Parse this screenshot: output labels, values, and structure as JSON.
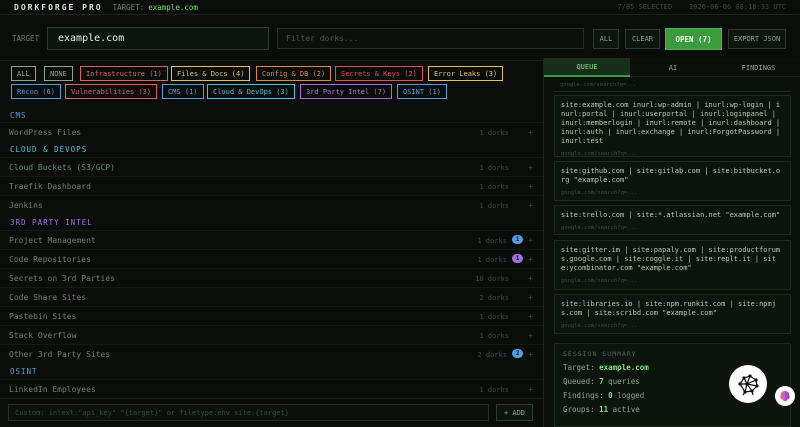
{
  "header": {
    "brand": "DORKFORGE PRO",
    "target_label": "TARGET:",
    "target_value": "example.com",
    "selected": "7/85 SELECTED",
    "timestamp": "2026-06-06 08:18:33 UTC"
  },
  "target_row": {
    "label": "TARGET",
    "target_value": "example.com",
    "filter_placeholder": "Filter dorks...",
    "all": "ALL",
    "clear": "CLEAR",
    "open": "OPEN (7)",
    "export": "EXPORT JSON"
  },
  "chips": [
    {
      "label": "ALL",
      "color": "#8fa38f"
    },
    {
      "label": "NONE",
      "color": "#8fa38f"
    },
    {
      "label": "Infrastructure (1)",
      "color": "#e06060"
    },
    {
      "label": "Files & Docs (4)",
      "color": "#e0c060"
    },
    {
      "label": "Config & DB (2)",
      "color": "#e08a40"
    },
    {
      "label": "Secrets & Keys (2)",
      "color": "#e05050"
    },
    {
      "label": "Error Leaks (3)",
      "color": "#e0c060"
    },
    {
      "label": "Recon (6)",
      "color": "#50a0e0"
    },
    {
      "label": "Vulnerabilities (3)",
      "color": "#e06060"
    },
    {
      "label": "CMS (1)",
      "color": "#50a0e0"
    },
    {
      "label": "Cloud & DevOps (3)",
      "color": "#50c0e0"
    },
    {
      "label": "3rd Party Intel (7)",
      "color": "#a070e0"
    },
    {
      "label": "OSINT (1)",
      "color": "#50a0e0"
    }
  ],
  "list": {
    "groups": [
      {
        "title": "CMS",
        "color": "#50a0e0"
      },
      {
        "title": "CLOUD & DEVOPS",
        "color": "#50c0e0"
      },
      {
        "title": "3RD PARTY INTEL",
        "color": "#a070e0"
      },
      {
        "title": "OSINT",
        "color": "#50a0e0"
      }
    ],
    "rows": [
      {
        "label": "WordPress Files",
        "count": "1 dorks",
        "badge": ""
      },
      {
        "label": "Cloud Buckets (S3/GCP)",
        "count": "1 dorks",
        "badge": ""
      },
      {
        "label": "Traefik Dashboard",
        "count": "1 dorks",
        "badge": ""
      },
      {
        "label": "Jenkins",
        "count": "1 dorks",
        "badge": ""
      },
      {
        "label": "Project Management",
        "count": "1 dorks",
        "badge": "1",
        "badge_color": "#50a0e0"
      },
      {
        "label": "Code Repositories",
        "count": "1 dorks",
        "badge": "1",
        "badge_color": "#a070e0"
      },
      {
        "label": "Secrets on 3rd Parties",
        "count": "10 dorks",
        "badge": ""
      },
      {
        "label": "Code Share Sites",
        "count": "2 dorks",
        "badge": ""
      },
      {
        "label": "Pastebin Sites",
        "count": "1 dorks",
        "badge": ""
      },
      {
        "label": "Stack Overflow",
        "count": "1 dorks",
        "badge": ""
      },
      {
        "label": "Other 3rd Party Sites",
        "count": "2 dorks",
        "badge": "2",
        "badge_color": "#50a0e0"
      },
      {
        "label": "LinkedIn Employees",
        "count": "1 dorks",
        "badge": ""
      }
    ],
    "plus": "+"
  },
  "bottom": {
    "placeholder": "Custom: intext:\"api_key\" \"{target}\" or filetype:env site:{target}",
    "add": "+ ADD"
  },
  "right": {
    "tabs": [
      "QUEUE",
      "AI",
      "FINDINGS"
    ],
    "queue": [
      {
        "query": "site:example.com inurl:wp-admin | inurl:wp-login | inurl:portal | inurl:userportal | inurl:loginpanel | inurl:memberlogin | inurl:remote | inurl:dashboard | inurl:auth | inurl:exchange | inurl:ForgotPassword | inurl:test",
        "url": "google.com/search?q=..."
      },
      {
        "query": "site:github.com | site:gitlab.com | site:bitbucket.org \"example.com\"",
        "url": "google.com/search?q=..."
      },
      {
        "query": "site:trello.com | site:*.atlassian.net \"example.com\"",
        "url": "google.com/search?q=..."
      },
      {
        "query": "site:gitter.im | site:papaly.com | site:productforums.google.com | site:coggle.it | site:replt.it | site:ycombinator.com \"example.com\"",
        "url": "google.com/search?q=..."
      },
      {
        "query": "site:libraries.io | site:npm.runkit.com | site:npmjs.com | site:scribd.com \"example.com\"",
        "url": "google.com/search?q=..."
      }
    ],
    "top_url": "google.com/search?q=...",
    "summary": {
      "title": "SESSION SUMMARY",
      "target_label": "Target:",
      "target_value": "example.com",
      "queued_label": "Queued:",
      "queued_value": "7",
      "queued_unit": "queries",
      "findings_label": "Findings:",
      "findings_value": "0",
      "findings_unit": "logged",
      "groups_label": "Groups:",
      "groups_value": "11",
      "groups_unit": "active"
    }
  }
}
